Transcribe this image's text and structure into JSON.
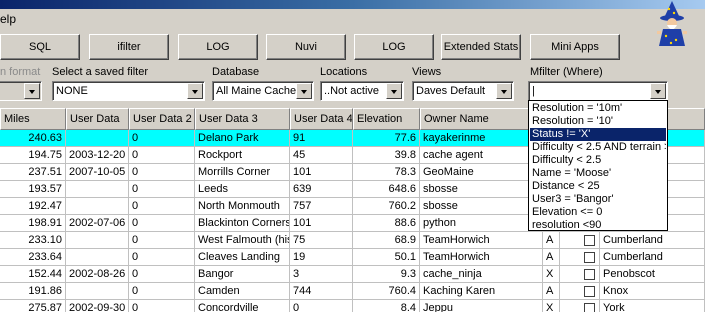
{
  "menu": {
    "partial_label": "elp"
  },
  "toolbar": {
    "buttons": [
      "SQL",
      "ifilter",
      "LOG",
      "Nuvi",
      "LOG",
      "Extended Stats",
      "Mini Apps"
    ]
  },
  "filters": {
    "format_label": "n format",
    "saved_filter_label": "Select a saved filter",
    "saved_filter_value": "NONE",
    "database_label": "Database",
    "database_value": "All Maine Caches",
    "locations_label": "Locations",
    "locations_value": "..Not active",
    "views_label": "Views",
    "views_value": "Daves Default",
    "mfilter_label": "Mfilter (Where)",
    "mfilter_value": "|"
  },
  "grid": {
    "headers": [
      "Miles",
      "User Data",
      "User Data 2",
      "User Data 3",
      "User Data 4",
      "Elevation",
      "Owner Name"
    ],
    "rows": [
      [
        "240.63",
        "",
        "0",
        "Delano Park",
        "91",
        "77.6",
        "kayakerinme",
        "",
        "",
        ""
      ],
      [
        "194.75",
        "2003-12-20",
        "0",
        "Rockport",
        "45",
        "39.8",
        "cache agent",
        "",
        "",
        ""
      ],
      [
        "237.51",
        "2007-10-05",
        "0",
        "Morrills Corner",
        "101",
        "78.3",
        "GeoMaine",
        "",
        "",
        ""
      ],
      [
        "193.57",
        "",
        "0",
        "Leeds",
        "639",
        "648.6",
        "sbosse",
        "",
        "",
        ""
      ],
      [
        "192.47",
        "",
        "0",
        "North Monmouth",
        "757",
        "760.2",
        "sbosse",
        "",
        "",
        ""
      ],
      [
        "198.91",
        "2002-07-06",
        "0",
        "Blackinton Corners",
        "101",
        "88.6",
        "python",
        "",
        "",
        ""
      ],
      [
        "233.10",
        "",
        "0",
        "West Falmouth (his",
        "75",
        "68.9",
        "TeamHorwich",
        "A",
        "",
        "Cumberland"
      ],
      [
        "233.64",
        "",
        "0",
        "Cleaves Landing",
        "19",
        "50.1",
        "TeamHorwich",
        "A",
        "",
        "Cumberland"
      ],
      [
        "152.44",
        "2002-08-26",
        "0",
        "Bangor",
        "3",
        "9.3",
        "cache_ninja",
        "X",
        "",
        "Penobscot"
      ],
      [
        "191.86",
        "",
        "0",
        "Camden",
        "744",
        "760.4",
        "Kaching Karen",
        "A",
        "",
        "Knox"
      ],
      [
        "275.87",
        "2002-09-30",
        "0",
        "Concordville",
        "0",
        "8.4",
        "Jeppu",
        "X",
        "",
        "York"
      ]
    ]
  },
  "mfilter_dropdown": {
    "options": [
      "Resolution = '10m'",
      "Resolution = '10'",
      "Status != 'X'",
      "Difficulty < 2.5 AND terrain >",
      "Difficulty < 2.5",
      "Name = 'Moose'",
      "Distance < 25",
      "User3 = 'Bangor'",
      "Elevation <= 0",
      "resolution <90"
    ],
    "highlighted_index": 2
  }
}
